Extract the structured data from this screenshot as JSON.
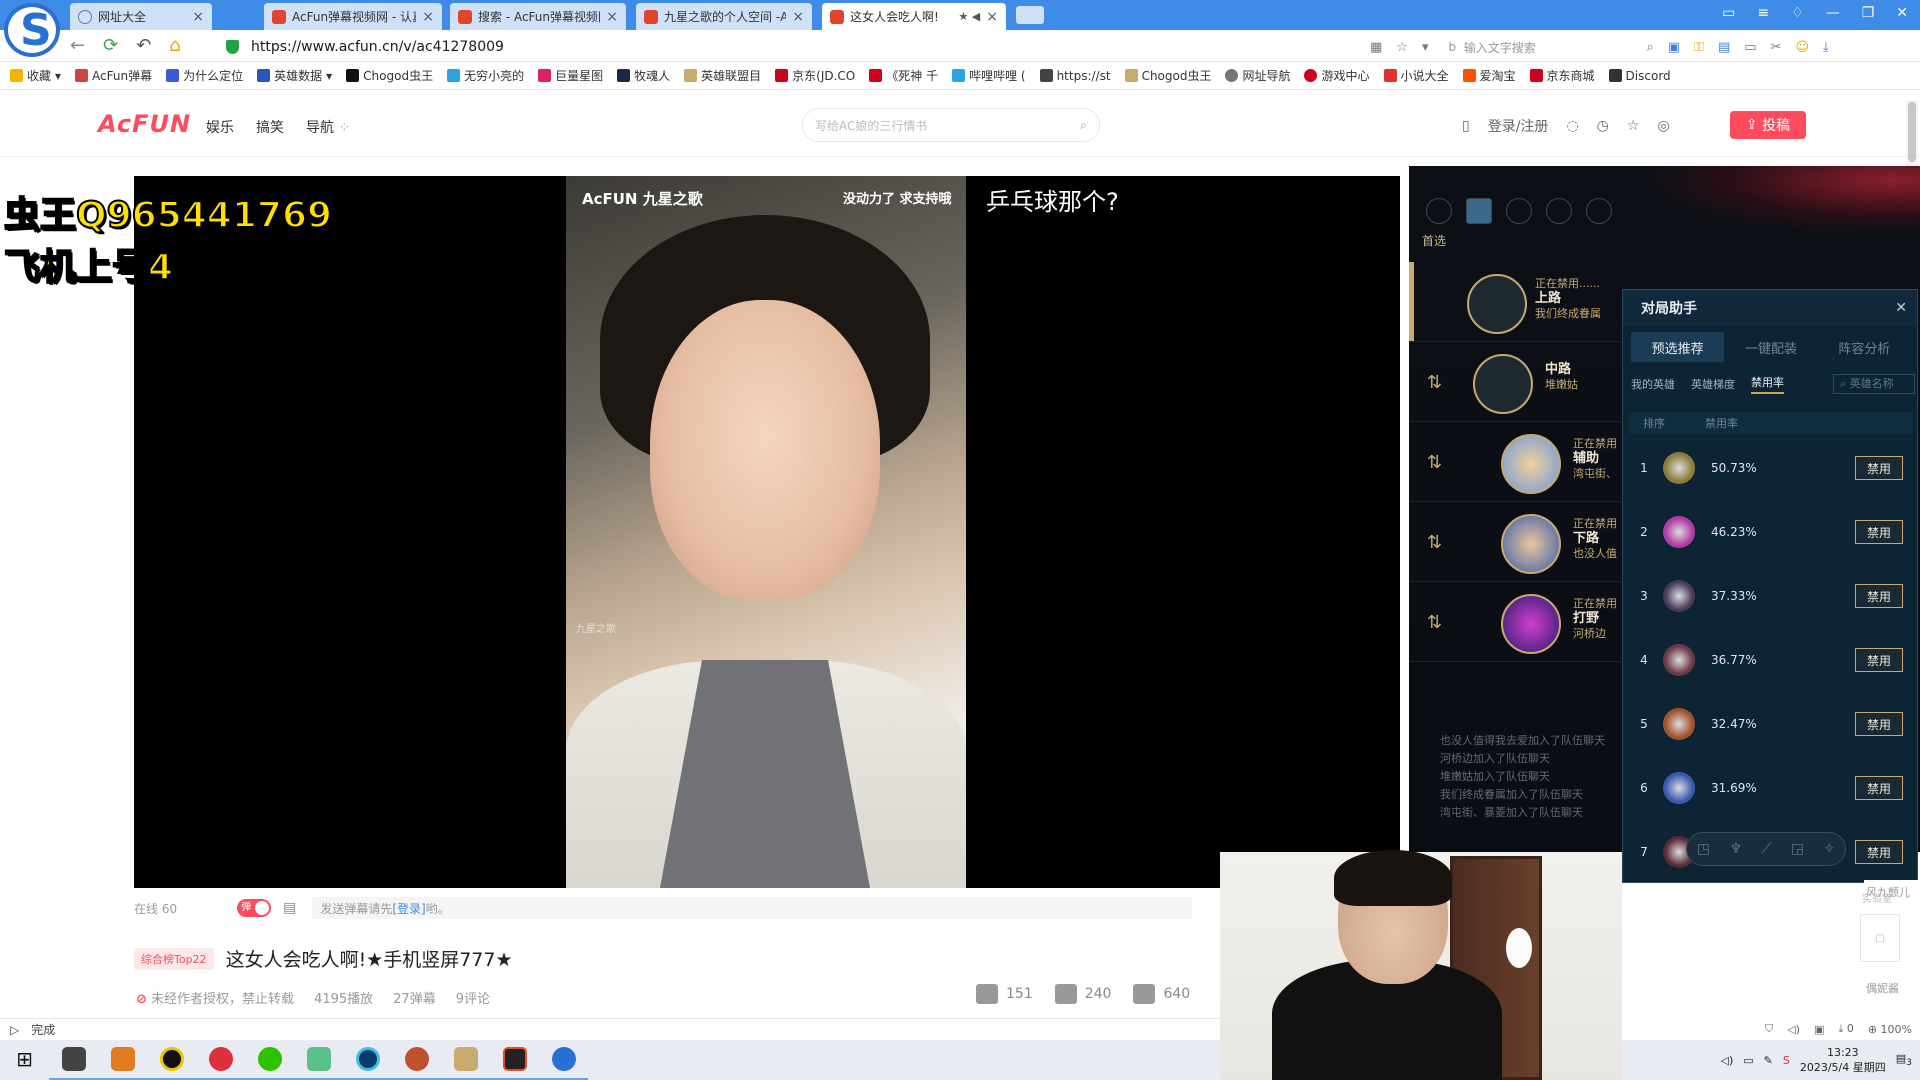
{
  "browser": {
    "tabs": [
      {
        "title": "网址大全"
      },
      {
        "title": "AcFun弹幕视频网 - 认真"
      },
      {
        "title": "搜索 - AcFun弹幕视频网"
      },
      {
        "title": "九星之歌的个人空间 -Ac"
      },
      {
        "title": "这女人会吃人啊!"
      }
    ],
    "url": "https://www.acfun.cn/v/ac41278009",
    "search_placeholder": "输入文字搜索",
    "bookmarks": [
      "收藏",
      "AcFun弹幕",
      "为什么定位",
      "英雄数据",
      "Chogod虫王",
      "无穷小亮的",
      "巨量星图",
      "牧魂人",
      "英雄联盟目",
      "京东(JD.CO",
      "《死神 千",
      "哔哩哔哩 (",
      "https://st",
      "Chogod虫王",
      "网址导航",
      "游戏中心",
      "小说大全",
      "爱淘宝",
      "京东商城",
      "Discord"
    ]
  },
  "acfun": {
    "logo": "AcFUN",
    "nav": [
      "娱乐",
      "搞笑",
      "导航"
    ],
    "search_placeholder": "写给AC娘的三行情书",
    "login": "登录/注册",
    "upload": "投稿"
  },
  "video": {
    "watermark": "AcFUN 九星之歌",
    "top_caption": "没动力了 求支持哦",
    "danmaku": "乒乓球那个?",
    "stream_overlay": [
      "虫王Q965441769",
      "飞机上号4盘"
    ],
    "photo_watermark": "九星之歌"
  },
  "controls": {
    "online": "在线 60",
    "danmu_toggle": "弹",
    "danmu_prompt_pre": "发送弹幕请先",
    "danmu_login": "[登录]",
    "danmu_prompt_post": "哟。"
  },
  "info": {
    "rank_badge": "综合榜Top22",
    "title": "这女人会吃人啊!★手机竖屏777★",
    "copyright": "未经作者授权，禁止转载",
    "plays": "4195播放",
    "danmaku_count": "27弹幕",
    "comments": "9评论",
    "likes": "151",
    "favorites": "240",
    "bananas": "640"
  },
  "game": {
    "first_pick_label": "首选",
    "picks": [
      {
        "status": "正在禁用......",
        "role": "上路",
        "name": "我们终成眷属"
      },
      {
        "status": "",
        "role": "中路",
        "name": "堆嫩姑"
      },
      {
        "status": "正在禁用",
        "role": "辅助",
        "name": "湾屯街、"
      },
      {
        "status": "正在禁用",
        "role": "下路",
        "name": "也没人值"
      },
      {
        "status": "正在禁用",
        "role": "打野",
        "name": "河桥边"
      }
    ],
    "chat": [
      "也没人值得我去爱加入了队伍聊天",
      "河桥边加入了队伍聊天",
      "堆嫩姑加入了队伍聊天",
      "我们终成眷属加入了队伍聊天",
      "湾屯街、暴菱加入了队伍聊天"
    ]
  },
  "assistant": {
    "title": "对局助手",
    "tabs": [
      "预选推荐",
      "一键配装",
      "阵容分析"
    ],
    "subtabs": [
      "我的英雄",
      "英雄梯度",
      "禁用率"
    ],
    "search_placeholder": "英雄名称",
    "col_rank": "排序",
    "col_rate": "禁用率",
    "ban_label": "禁用",
    "rows": [
      {
        "rank": "1",
        "rate": "50.73%",
        "color": "#8a7d3a"
      },
      {
        "rank": "2",
        "rate": "46.23%",
        "color": "#b23aa6"
      },
      {
        "rank": "3",
        "rate": "37.33%",
        "color": "#4a3a5c"
      },
      {
        "rank": "4",
        "rate": "36.77%",
        "color": "#6a3a4a"
      },
      {
        "rank": "5",
        "rate": "32.47%",
        "color": "#a0522d"
      },
      {
        "rank": "6",
        "rate": "31.69%",
        "color": "#3a5ab0"
      },
      {
        "rank": "7",
        "rate": "",
        "color": "#5a2a3a"
      }
    ]
  },
  "side": {
    "fenjiu": "风九颤儿",
    "ouxiang": "偶妮酱",
    "lab": "实验室"
  },
  "status": {
    "left": "完成",
    "zoom": "100%",
    "download": "0",
    "time": "13:23",
    "date": "2023/5/4 星期四",
    "notif": "3"
  }
}
